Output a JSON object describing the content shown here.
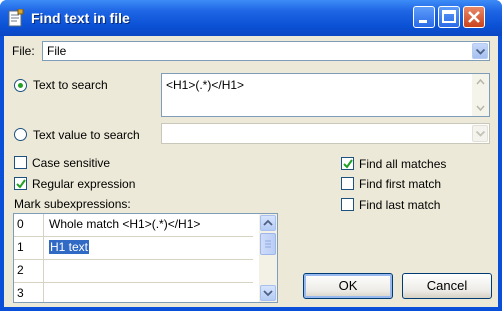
{
  "window": {
    "title": "Find text in file"
  },
  "file": {
    "label": "File:",
    "value": "File"
  },
  "text_to_search": {
    "label": "Text to search",
    "value": "<H1>(.*)</H1>",
    "selected": true
  },
  "text_value_to_search": {
    "label": "Text value to search",
    "value": "",
    "selected": false
  },
  "options": {
    "case_sensitive": {
      "label": "Case sensitive",
      "checked": false
    },
    "regular_expression": {
      "label": "Regular expression",
      "checked": true
    },
    "find_all": {
      "label": "Find all matches",
      "checked": true
    },
    "find_first": {
      "label": "Find first match",
      "checked": false
    },
    "find_last": {
      "label": "Find last match",
      "checked": false
    }
  },
  "subexpressions": {
    "label": "Mark subexpressions:",
    "rows": [
      {
        "index": "0",
        "value": "Whole match <H1>(.*)</H1>"
      },
      {
        "index": "1",
        "value": "H1 text"
      },
      {
        "index": "2",
        "value": ""
      },
      {
        "index": "3",
        "value": ""
      }
    ]
  },
  "buttons": {
    "ok": "OK",
    "cancel": "Cancel"
  },
  "colors": {
    "titlebar": "#0b52d6",
    "dialog": "#ece9d8",
    "selection": "#316ac5"
  }
}
